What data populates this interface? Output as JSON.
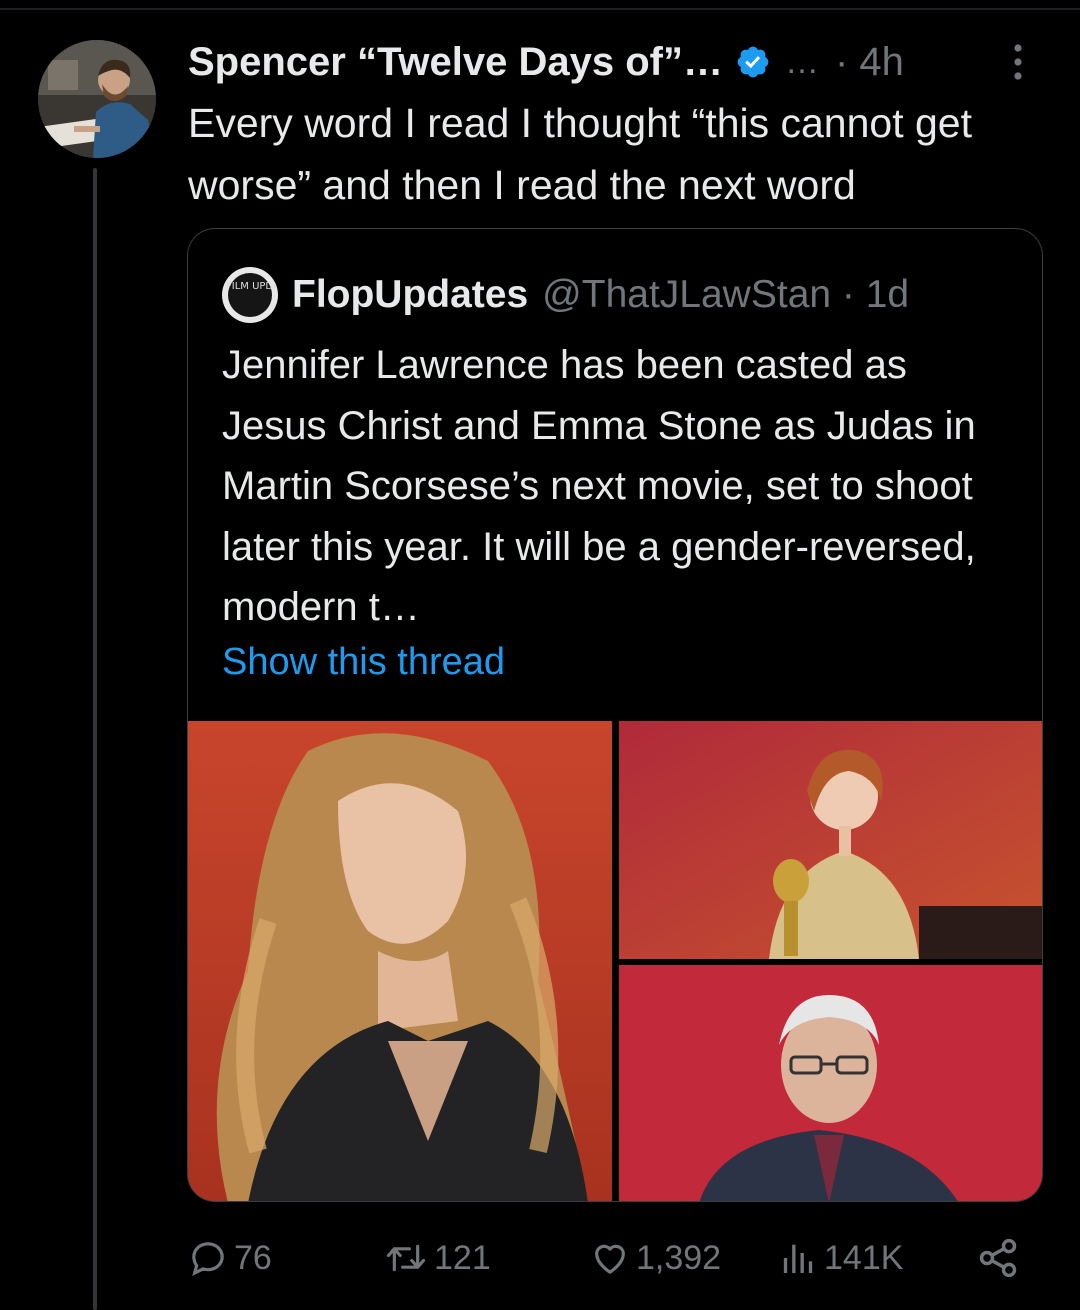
{
  "tweet": {
    "author_name": "Spencer “Twelve Days of”…",
    "extra": "…",
    "time": "· 4h",
    "text": "Every word I read I thought “this cannot get worse” and then I read the next word"
  },
  "quoted": {
    "avatar_label": "FILM UPDATES",
    "name": "FlopUpdates",
    "handle": "@ThatJLawStan · 1d",
    "text": "Jennifer Lawrence has been casted as Jesus Christ and Emma Stone as Judas in Martin Scorsese’s next movie, set to shoot later this year. It will be a gender-reversed, modern t…",
    "show_thread": "Show this thread"
  },
  "metrics": {
    "replies": "76",
    "reposts": "121",
    "likes": "1,392",
    "views": "141K"
  },
  "icons": {
    "verified": "verified-badge-icon",
    "more": "more-vertical-icon",
    "reply": "reply-icon",
    "repost": "repost-icon",
    "like": "heart-icon",
    "views": "views-chart-icon",
    "share": "share-icon"
  },
  "colors": {
    "background": "#000000",
    "text": "#e7e9ea",
    "muted": "#71767b",
    "accent": "#1d9bf0"
  }
}
